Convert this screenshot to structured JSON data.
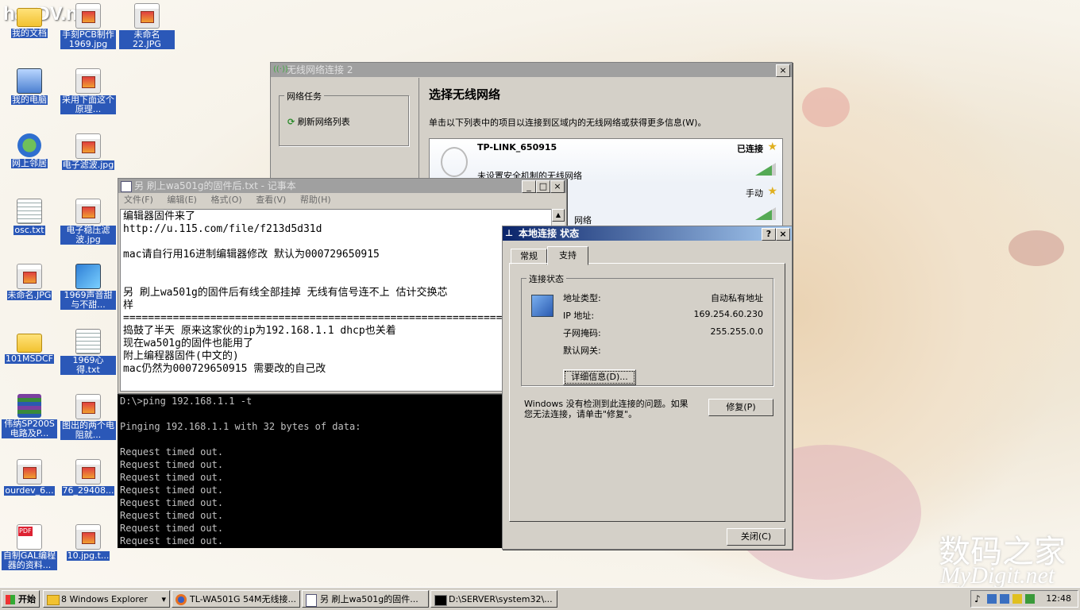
{
  "desktop": {
    "icons": [
      {
        "label": "我的文档",
        "icon": "folder-docs-icon"
      },
      {
        "label": "手刻PCB制作1969.jpg",
        "icon": "image-file-icon"
      },
      {
        "label": "未命名22.JPG",
        "icon": "image-file-icon"
      },
      {
        "label": "我的电脑",
        "icon": "computer-icon"
      },
      {
        "label": "采用下面这个原理...",
        "icon": "image-file-icon"
      },
      {
        "label": "网上邻居",
        "icon": "network-icon"
      },
      {
        "label": "电子滤波.jpg",
        "icon": "image-file-icon"
      },
      {
        "label": "osc.txt",
        "icon": "text-file-icon"
      },
      {
        "label": "电子稳压滤波.jpg",
        "icon": "image-file-icon"
      },
      {
        "label": "未命名.JPG",
        "icon": "image-file-icon"
      },
      {
        "label": "1969声音甜与不甜...",
        "icon": "document-icon"
      },
      {
        "label": "101MSDCF",
        "icon": "folder-icon"
      },
      {
        "label": "1969心得.txt",
        "icon": "text-file-icon"
      },
      {
        "label": "伟纳SP200S电路及P...",
        "icon": "rar-archive-icon"
      },
      {
        "label": "图出的两个电阻就...",
        "icon": "image-file-icon"
      },
      {
        "label": "ourdev_6...",
        "icon": "image-file-icon"
      },
      {
        "label": "76_29408...",
        "icon": "image-file-icon"
      },
      {
        "label": "自制GAL编程器的资料...",
        "icon": "pdf-file-icon"
      },
      {
        "label": "10.jpg.t...",
        "icon": "image-file-icon"
      }
    ],
    "logo_text": "hacDV.net",
    "watermark_cn": "数码之家",
    "watermark_en": "MyDigit.net"
  },
  "wireless_window": {
    "title": "无线网络连接 2",
    "close": "×",
    "task_group_title": "网络任务",
    "refresh_label": "刷新网络列表",
    "heading": "选择无线网络",
    "description": "单击以下列表中的项目以连接到区域内的无线网络或获得更多信息(W)。",
    "networks": [
      {
        "ssid": "TP-LINK_650915",
        "status": "已连接",
        "security": "未设置安全机制的无线网络"
      },
      {
        "ssid": "",
        "status": "手动",
        "security": "网络"
      }
    ]
  },
  "notepad": {
    "title": "另 刷上wa501g的固件后.txt - 记事本",
    "menu": [
      "文件(F)",
      "编辑(E)",
      "格式(O)",
      "查看(V)",
      "帮助(H)"
    ],
    "min": "_",
    "max": "□",
    "close": "×",
    "content": "编辑器固件来了\nhttp://u.115.com/file/f213d5d31d\n\nmac请自行用16进制编辑器修改 默认为000729650915\n\n\n另 刷上wa501g的固件后有线全部挂掉 无线有信号连不上 估计交换芯\n样\n================================================================\n捣鼓了半天 原来这家伙的ip为192.168.1.1 dhcp也关着\n现在wa501g的固件也能用了\n附上编程器固件(中文的)\nmac仍然为000729650915 需要改的自己改"
  },
  "cmd": {
    "content": "D:\\>ping 192.168.1.1 -t\n\nPinging 192.168.1.1 with 32 bytes of data:\n\nRequest timed out.\nRequest timed out.\nRequest timed out.\nRequest timed out.\nRequest timed out.\nRequest timed out.\nRequest timed out.\nRequest timed out."
  },
  "status_dialog": {
    "title": "本地连接 状态",
    "help": "?",
    "close": "×",
    "tabs": [
      "常规",
      "支持"
    ],
    "group_title": "连接状态",
    "rows": [
      {
        "label": "地址类型:",
        "value": "自动私有地址"
      },
      {
        "label": "IP 地址:",
        "value": "169.254.60.230"
      },
      {
        "label": "子网掩码:",
        "value": "255.255.0.0"
      },
      {
        "label": "默认网关:",
        "value": ""
      }
    ],
    "details_button": "详细信息(D)...",
    "message": "Windows 没有检测到此连接的问题。如果\n您无法连接，请单击\"修复\"。",
    "repair_button": "修复(P)",
    "close_button": "关闭(C)"
  },
  "taskbar": {
    "start": "开始",
    "items": [
      {
        "label": "8 Windows Explorer",
        "icon": "folder-icon"
      },
      {
        "label": "TL-WA501G 54M无线接...",
        "icon": "firefox-icon"
      },
      {
        "label": "另 刷上wa501g的固件...",
        "icon": "notepad-icon"
      },
      {
        "label": "D:\\SERVER\\system32\\...",
        "icon": "cmd-icon"
      }
    ],
    "clock": "12:48"
  }
}
